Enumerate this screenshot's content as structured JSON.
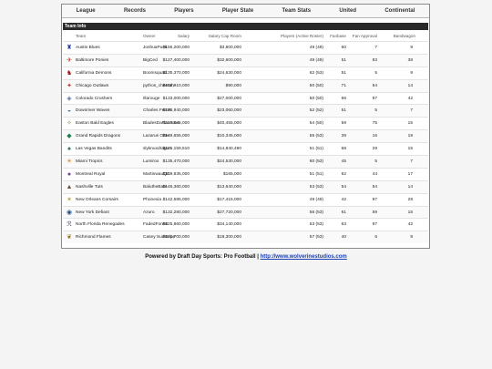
{
  "nav": [
    "League",
    "Records",
    "Players",
    "Player State",
    "Team Stats",
    "United",
    "Continental"
  ],
  "section_title": "Team Info",
  "columns": [
    "Team",
    "Owner",
    "Salary",
    "Salary Cap Room",
    "Players (Active Roster)",
    "Fanbase",
    "Fan Approval",
    "Bandwagon"
  ],
  "teams": [
    {
      "icon": "♜",
      "color": "#2a3f9e",
      "team": "Austin Blues",
      "owner": "JoshuaPuck",
      "salary": "$156,200,000",
      "cap": "$3,800,000",
      "players": "49 (49)",
      "fanbase": "60",
      "approval": "7",
      "bandwagon": "9"
    },
    {
      "icon": "✈",
      "color": "#c0392b",
      "team": "Baltimore Ponies",
      "owner": "BigCed",
      "salary": "$127,400,000",
      "cap": "$32,600,000",
      "players": "49 (49)",
      "fanbase": "51",
      "approval": "83",
      "bandwagon": "38"
    },
    {
      "icon": "♞",
      "color": "#a01818",
      "team": "California Demons",
      "owner": "Boomsquad",
      "salary": "$135,370,000",
      "cap": "$24,630,000",
      "players": "62 (53)",
      "fanbase": "51",
      "approval": "5",
      "bandwagon": "9"
    },
    {
      "icon": "✦",
      "color": "#c0392b",
      "team": "Chicago Outlaws",
      "owner": "pythos_cheetah",
      "salary": "$159,910,000",
      "cap": "$90,000",
      "players": "50 (50)",
      "fanbase": "71",
      "approval": "54",
      "bandwagon": "14"
    },
    {
      "icon": "◈",
      "color": "#5a6fa8",
      "team": "Colorado Crushers",
      "owner": "Illarouge",
      "salary": "$133,000,000",
      "cap": "$27,000,000",
      "players": "50 (50)",
      "fanbase": "66",
      "approval": "97",
      "bandwagon": "42"
    },
    {
      "icon": "◒",
      "color": "#2e86c1",
      "team": "Downriver Waves",
      "owner": "Charles Ferret",
      "salary": "$136,940,000",
      "cap": "$23,060,000",
      "players": "52 (52)",
      "fanbase": "51",
      "approval": "5",
      "bandwagon": "7"
    },
    {
      "icon": "✧",
      "color": "#8a7a3a",
      "team": "Easton Bald Eagles",
      "owner": "BladesDaRaccoon",
      "salary": "$119,545,000",
      "cap": "$40,455,000",
      "players": "54 (50)",
      "fanbase": "59",
      "approval": "75",
      "bandwagon": "15"
    },
    {
      "icon": "◆",
      "color": "#1e7d4a",
      "team": "Grand Rapids Dragons",
      "owner": "Lazarus Otter",
      "salary": "$149,655,000",
      "cap": "$10,345,000",
      "players": "55 (53)",
      "fanbase": "39",
      "approval": "16",
      "bandwagon": "19"
    },
    {
      "icon": "♠",
      "color": "#2a6f5a",
      "team": "Las Vegas Bandits",
      "owner": "slyknuxdragon",
      "salary": "$145,159,510",
      "cap": "$14,840,490",
      "players": "51 (51)",
      "fanbase": "68",
      "approval": "29",
      "bandwagon": "15"
    },
    {
      "icon": "☀",
      "color": "#e67e22",
      "team": "Miami Tropics",
      "owner": "Lumiroo",
      "salary": "$135,470,000",
      "cap": "$24,530,000",
      "players": "60 (53)",
      "fanbase": "45",
      "approval": "5",
      "bandwagon": "7"
    },
    {
      "icon": "●",
      "color": "#6b3fa0",
      "team": "Montreal Royal",
      "owner": "MartinwauQC",
      "salary": "$159,835,000",
      "cap": "$165,000",
      "players": "51 (51)",
      "fanbase": "62",
      "approval": "44",
      "bandwagon": "17"
    },
    {
      "icon": "▲",
      "color": "#6e4a2a",
      "team": "Nashville Tuts",
      "owner": "BaluthеBare",
      "salary": "$146,360,000",
      "cap": "$13,640,000",
      "players": "53 (53)",
      "fanbase": "54",
      "approval": "54",
      "bandwagon": "14"
    },
    {
      "icon": "✶",
      "color": "#b8962e",
      "team": "New Orleans Corsairs",
      "owner": "Phonexia",
      "salary": "$142,585,000",
      "cap": "$17,415,000",
      "players": "49 (49)",
      "fanbase": "42",
      "approval": "97",
      "bandwagon": "28"
    },
    {
      "icon": "◉",
      "color": "#1e4a8a",
      "team": "New York Defiant",
      "owner": "Azuro",
      "salary": "$132,280,000",
      "cap": "$27,720,000",
      "players": "56 (53)",
      "fanbase": "61",
      "approval": "59",
      "bandwagon": "15"
    },
    {
      "icon": "ℛ",
      "color": "#3a2a6a",
      "team": "North Florida Renegades",
      "owner": "FadedForest",
      "salary": "$125,860,000",
      "cap": "$34,140,000",
      "players": "53 (53)",
      "fanbase": "63",
      "approval": "97",
      "bandwagon": "42"
    },
    {
      "icon": "❦",
      "color": "#a06a1a",
      "team": "Richmond Flames",
      "owner": "Casey Sunstripe",
      "salary": "$141,700,000",
      "cap": "$18,300,000",
      "players": "57 (53)",
      "fanbase": "40",
      "approval": "6",
      "bandwagon": "8"
    }
  ],
  "footer": {
    "text": "Powered by Draft Day Sports: Pro Football | ",
    "link": "http://www.wolverinestudios.com"
  }
}
